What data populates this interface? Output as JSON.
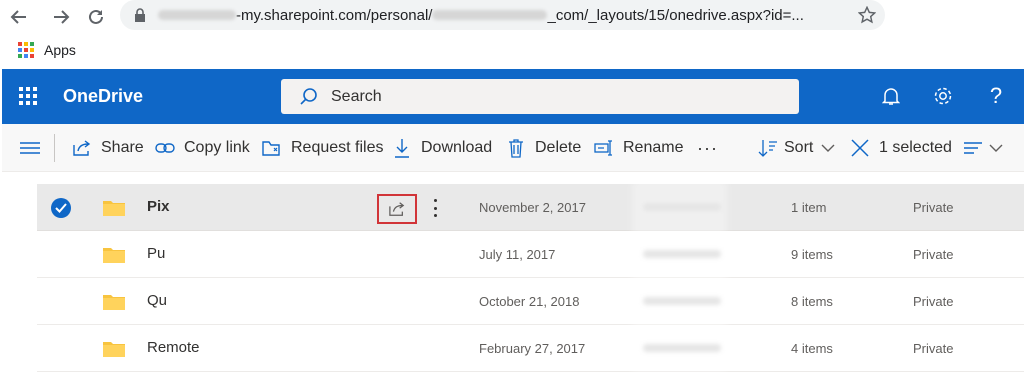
{
  "browser": {
    "url_blurred_start": "",
    "url_visible_1": "-my.sharepoint.com/personal/",
    "url_visible_2": "_com/_layouts/15/onedrive.aspx?id=...",
    "bookmarks_apps_label": "Apps",
    "apps_colors": [
      "#ea4335",
      "#fbbc04",
      "#34a853",
      "#4285f4",
      "#ea4335",
      "#fbbc04",
      "#34a853",
      "#4285f4",
      "#ea4335"
    ]
  },
  "suite": {
    "brand": "OneDrive",
    "search_placeholder": "Search",
    "accent": "#0f67c7",
    "icons": [
      "bell-icon",
      "gear-icon",
      "help-icon"
    ]
  },
  "commands": {
    "share": "Share",
    "copy_link": "Copy link",
    "request_files": "Request files",
    "download": "Download",
    "delete": "Delete",
    "rename": "Rename",
    "more": "···",
    "sort": "Sort",
    "selected": "1 selected"
  },
  "files": [
    {
      "name": "Pix",
      "modified": "November 2, 2017",
      "size": "1 item",
      "sharing": "Private",
      "selected": true
    },
    {
      "name": "Pu",
      "modified": "July 11, 2017",
      "size": "9 items",
      "sharing": "Private",
      "selected": false
    },
    {
      "name": "Qu",
      "modified": "October 21, 2018",
      "size": "8 items",
      "sharing": "Private",
      "selected": false
    },
    {
      "name": "Remote",
      "modified": "February 27, 2017",
      "size": "4 items",
      "sharing": "Private",
      "selected": false
    }
  ]
}
